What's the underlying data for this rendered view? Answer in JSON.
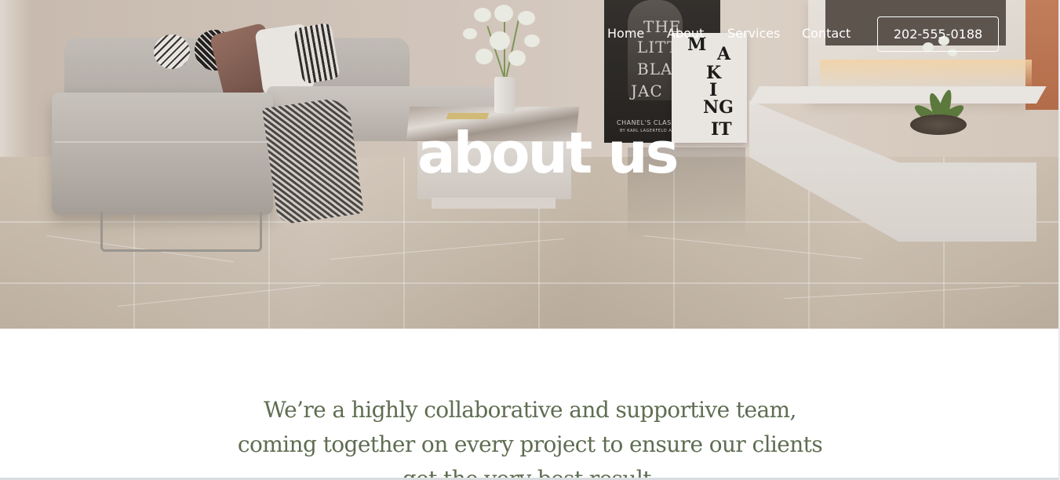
{
  "nav": {
    "links": [
      {
        "label": "Home"
      },
      {
        "label": "About"
      },
      {
        "label": "Services"
      },
      {
        "label": "Contact"
      }
    ],
    "phone": "202-555-0188"
  },
  "hero": {
    "title": "about us",
    "poster_dark": {
      "lines": [
        "THE",
        "LITT",
        "BLA",
        "JAC"
      ],
      "caption": "CHANEL'S CLASS",
      "byline": "BY KARL LAGERFELD AND"
    },
    "poster_light": {
      "letters": [
        "M",
        "A",
        "K",
        "I",
        "NG",
        "IT"
      ]
    }
  },
  "content": {
    "intro": "We’re a highly collaborative and supportive team, coming together on every project to ensure our clients get the very best result."
  },
  "colors": {
    "intro_text": "#5f6d52",
    "nav_text": "#ffffff",
    "accent_copper": "#c9805b"
  }
}
